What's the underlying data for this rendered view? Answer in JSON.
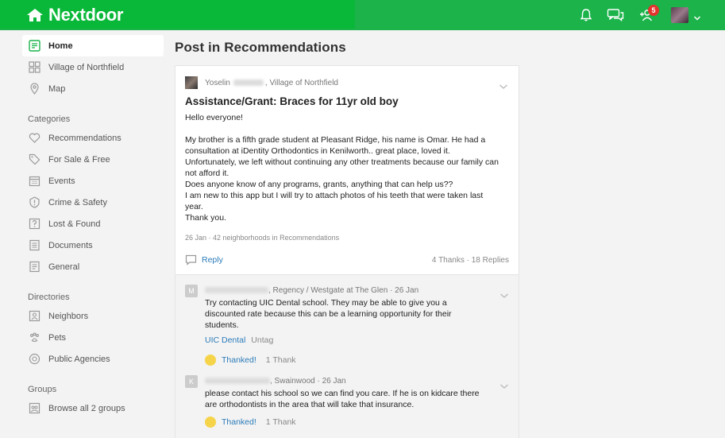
{
  "brand": {
    "name": "Nextdoor",
    "color": "#1bb34a"
  },
  "topbar": {
    "icons": [
      "bell-icon",
      "messages-icon",
      "invite-neighbors-icon",
      "profile-avatar",
      "chevron-down-icon"
    ],
    "notification_count": "5"
  },
  "sidebar": {
    "primary": [
      {
        "label": "Home",
        "icon": "home-icon",
        "active": true
      },
      {
        "label": "Village of Northfield",
        "icon": "neighborhood-icon"
      },
      {
        "label": "Map",
        "icon": "map-pin-icon"
      }
    ],
    "categories_heading": "Categories",
    "categories": [
      {
        "label": "Recommendations",
        "icon": "heart-icon"
      },
      {
        "label": "For Sale & Free",
        "icon": "tag-icon"
      },
      {
        "label": "Events",
        "icon": "calendar-icon"
      },
      {
        "label": "Crime & Safety",
        "icon": "shield-icon"
      },
      {
        "label": "Lost & Found",
        "icon": "question-icon"
      },
      {
        "label": "Documents",
        "icon": "document-icon"
      },
      {
        "label": "General",
        "icon": "list-icon"
      }
    ],
    "directories_heading": "Directories",
    "directories": [
      {
        "label": "Neighbors",
        "icon": "person-icon"
      },
      {
        "label": "Pets",
        "icon": "paw-icon"
      },
      {
        "label": "Public Agencies",
        "icon": "badge-icon"
      }
    ],
    "groups_heading": "Groups",
    "groups": [
      {
        "label": "Browse all 2 groups",
        "icon": "group-icon"
      }
    ]
  },
  "main": {
    "title": "Post in Recommendations",
    "post": {
      "author_first": "Yoselin",
      "author_location": ", Village of Northfield",
      "title": "Assistance/Grant: Braces for 11yr old boy",
      "body": "Hello everyone!\n\nMy brother is a fifth grade student at Pleasant Ridge, his name is Omar. He had a consultation at iDentity Orthodontics in Kenilworth.. great place, loved it. Unfortunately, we left without continuing any other treatments because our family can not afford it.\nDoes anyone know of any programs, grants, anything that can help us??\nI am new to this app but I will try to attach photos of his teeth that were taken last year.\nThank you.",
      "meta": "26 Jan · 42 neighborhoods in Recommendations",
      "reply_label": "Reply",
      "stats": "4 Thanks · 18 Replies"
    },
    "comments": [
      {
        "avatar_letter": "M",
        "author_suffix": ", Regency / Westgate at The Glen · 26 Jan",
        "text": "Try contacting UIC Dental school.  They may be able to give you a discounted rate because this can be a learning opportunity for their students.",
        "tag_link": "UIC Dental",
        "tag_action": "Untag",
        "thanked_label": "Thanked!",
        "thank_count": "1 Thank"
      },
      {
        "avatar_letter": "K",
        "author_suffix": ", Swainwood  · 26 Jan",
        "text": "please contact his school so we can find you care. If he is on kidcare there are orthodontists in the area that will take that insurance.",
        "thanked_label": "Thanked!",
        "thank_count": "1 Thank"
      }
    ]
  }
}
